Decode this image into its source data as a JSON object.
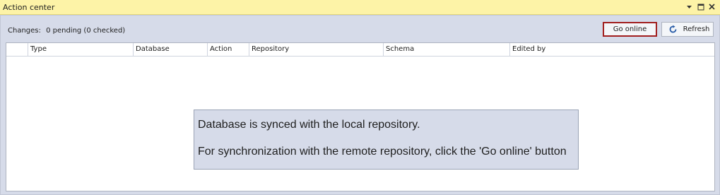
{
  "window": {
    "title": "Action center",
    "controls": [
      "dropdown-arrow-icon",
      "maximize-icon",
      "close-icon"
    ]
  },
  "toolbar": {
    "changes_label": "Changes:",
    "changes_value": "0 pending (0 checked)",
    "go_online_label": "Go online",
    "refresh_label": "Refresh",
    "refresh_icon": "refresh-icon"
  },
  "grid": {
    "columns": [
      "Type",
      "Database",
      "Action",
      "Repository",
      "Schema",
      "Edited by"
    ],
    "rows": []
  },
  "message": {
    "line1": "Database is synced with the local repository.",
    "line2": "For synchronization with the remote repository, click the 'Go online' button"
  },
  "colors": {
    "titlebar": "#fdf3a7",
    "panel": "#d6dbe9",
    "go_online_border": "#a11e1e",
    "refresh_icon": "#2a5da8"
  }
}
